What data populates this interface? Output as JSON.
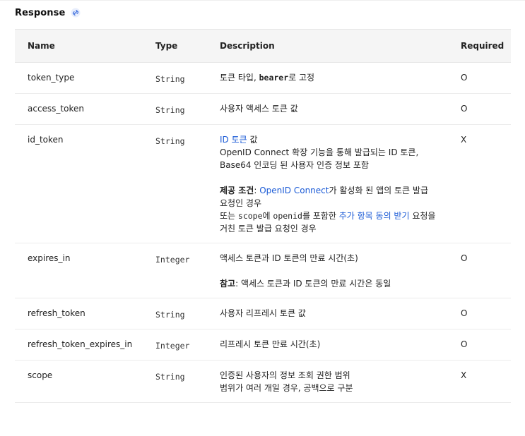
{
  "section": {
    "title": "Response",
    "icon": "link-icon"
  },
  "headers": {
    "name": "Name",
    "type": "Type",
    "description": "Description",
    "required": "Required"
  },
  "rows": [
    {
      "name": "token_type",
      "type": "String",
      "desc": {
        "t1": "토큰 타입, ",
        "code1": "bearer",
        "t2": "로 고정"
      },
      "required": "O"
    },
    {
      "name": "access_token",
      "type": "String",
      "desc": {
        "line1": "사용자 액세스 토큰 값"
      },
      "required": "O"
    },
    {
      "name": "id_token",
      "type": "String",
      "desc": {
        "link1": "ID 토큰",
        "t1": " 값",
        "line2": "OpenID Connect 확장 기능을 통해 발급되는 ID 토큰,",
        "line3": "Base64 인코딩 된 사용자 인증 정보 포함",
        "cond_label": "제공 조건",
        "cond_sep": ": ",
        "link2": "OpenID Connect",
        "cond_t1": "가 활성화 된 앱의 토큰 발급",
        "cond_line2": "요청인 경우",
        "or_t1": "또는 ",
        "code_scope": "scope",
        "or_t2": "에 ",
        "code_openid": "openid",
        "or_t3": "를 포함한 ",
        "link3": "추가 항목 동의 받기",
        "or_t4": " 요청을",
        "or_line2": "거친 토큰 발급 요청인 경우"
      },
      "required": "X"
    },
    {
      "name": "expires_in",
      "type": "Integer",
      "desc": {
        "line1": "액세스 토큰과 ID 토큰의 만료 시간(초)",
        "note_label": "참고",
        "note_text": ": 액세스 토큰과 ID 토큰의 만료 시간은 동일"
      },
      "required": "O"
    },
    {
      "name": "refresh_token",
      "type": "String",
      "desc": {
        "line1": "사용자 리프레시 토큰 값"
      },
      "required": "O"
    },
    {
      "name": "refresh_token_expires_in",
      "type": "Integer",
      "desc": {
        "line1": "리프레시 토큰 만료 시간(초)"
      },
      "required": "O"
    },
    {
      "name": "scope",
      "type": "String",
      "desc": {
        "line1": "인증된 사용자의 정보 조회 권한 범위",
        "line2": "범위가 여러 개일 경우, 공백으로 구분"
      },
      "required": "X"
    }
  ]
}
